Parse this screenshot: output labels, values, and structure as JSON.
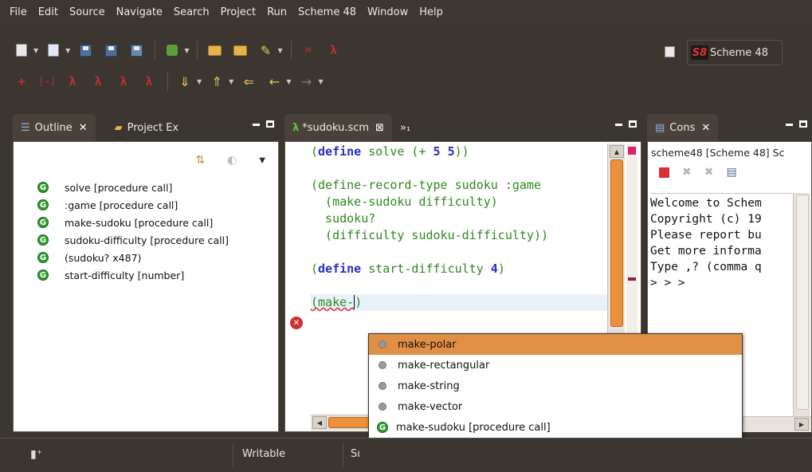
{
  "menu": [
    "File",
    "Edit",
    "Source",
    "Navigate",
    "Search",
    "Project",
    "Run",
    "Scheme 48",
    "Window",
    "Help"
  ],
  "perspective": {
    "badge": "S8",
    "label": "Scheme 48"
  },
  "outline": {
    "tabs": [
      {
        "label": "Outline",
        "close": "✕"
      },
      {
        "label": "Project Ex"
      }
    ],
    "items": [
      "solve [procedure call]",
      ":game [procedure call]",
      "make-sudoku [procedure call]",
      "sudoku-difficulty [procedure call]",
      "(sudoku? x487)",
      "start-difficulty [number]"
    ]
  },
  "editor": {
    "tabs": [
      {
        "label": "*sudoku.scm",
        "close": "⊠"
      },
      {
        "label": "»₁"
      }
    ]
  },
  "console": {
    "tab": {
      "label": "Cons",
      "close": "✕"
    },
    "launch_label": "scheme48 [Scheme 48] Sc",
    "lines": [
      "Welcome to Schem",
      "Copyright (c) 19",
      "Please report bu",
      "Get more informa",
      "Type ,? (comma q",
      "> > >"
    ]
  },
  "completion": {
    "items": [
      {
        "label": "make-polar",
        "icon": "grey-dot-icon",
        "selected": true
      },
      {
        "label": "make-rectangular",
        "icon": "grey-dot-icon"
      },
      {
        "label": "make-string",
        "icon": "grey-dot-icon"
      },
      {
        "label": "make-vector",
        "icon": "grey-dot-icon"
      },
      {
        "label": "make-sudoku [procedure call]",
        "icon": "green-g-icon"
      }
    ]
  },
  "status": {
    "mode": "Writable",
    "truncated": "Sı"
  },
  "colors": {
    "background": "#3c3630",
    "selection": "#e08f45",
    "keyword": "#2b2fbe",
    "code": "#2c8a1c",
    "error": "#d03030"
  }
}
